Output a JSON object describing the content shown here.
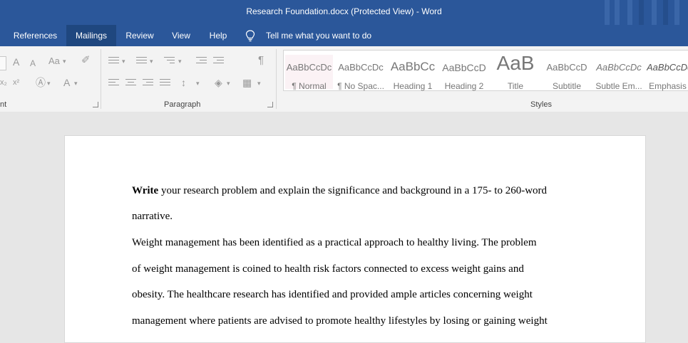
{
  "window": {
    "title": "Research Foundation.docx (Protected View)  -  Word"
  },
  "tabs": [
    {
      "label": "References"
    },
    {
      "label": "Mailings"
    },
    {
      "label": "Review"
    },
    {
      "label": "View"
    },
    {
      "label": "Help"
    }
  ],
  "tell_me": {
    "label": "Tell me what you want to do",
    "icon": "lightbulb-icon"
  },
  "groups": {
    "font": "nt",
    "paragraph": "Paragraph",
    "styles": "Styles"
  },
  "font_controls": {
    "aa": "Aa",
    "superscript": "x²",
    "subscript": "x₂",
    "grow": "A",
    "shrink": "A"
  },
  "styles": [
    {
      "preview": "AaBbCcDc",
      "name": "¶ Normal"
    },
    {
      "preview": "AaBbCcDc",
      "name": "¶ No Spac..."
    },
    {
      "preview": "AaBbCc",
      "name": "Heading 1"
    },
    {
      "preview": "AaBbCcD",
      "name": "Heading 2"
    },
    {
      "preview": "AaB",
      "name": "Title"
    },
    {
      "preview": "AaBbCcD",
      "name": "Subtitle"
    },
    {
      "preview": "AaBbCcDc",
      "name": "Subtle Em..."
    },
    {
      "preview": "AaBbCcDc",
      "name": "Emphasis"
    }
  ],
  "document": {
    "prompt_bold": "Write",
    "prompt_rest": " your research problem and explain the significance and background in a 175- to 260-word",
    "prompt_line2": "narrative.",
    "body_lines": [
      "Weight management has been identified as a practical approach to healthy living. The problem",
      "of weight management is coined to health risk factors connected to excess weight gains and",
      "obesity. The healthcare research has identified and provided ample articles concerning weight",
      "management where patients are advised to promote healthy lifestyles by losing or gaining weight"
    ]
  },
  "colors": {
    "ribbon_blue": "#2b579a",
    "active_tab": "#1f477f"
  }
}
